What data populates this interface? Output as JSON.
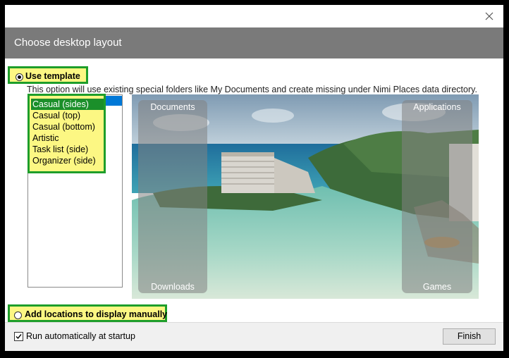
{
  "dialog": {
    "close_icon": "close-icon",
    "title": "Choose desktop layout"
  },
  "template_option": {
    "label": "Use template",
    "selected": true,
    "description": "This option will use existing special folders like My Documents and create missing under Nimi Places data directory."
  },
  "layouts": {
    "items": [
      {
        "label": "Casual (sides)",
        "selected": true
      },
      {
        "label": "Casual (top)",
        "selected": false
      },
      {
        "label": "Casual (bottom)",
        "selected": false
      },
      {
        "label": "Artistic",
        "selected": false
      },
      {
        "label": "Task list (side)",
        "selected": false
      },
      {
        "label": "Organizer (side)",
        "selected": false
      }
    ]
  },
  "preview": {
    "panels": {
      "top_left": "Documents",
      "bottom_left": "Downloads",
      "top_right": "Applications",
      "bottom_right": "Games"
    }
  },
  "manual_option": {
    "label": "Add locations to display manually",
    "selected": false
  },
  "footer": {
    "startup_label": "Run automatically at startup",
    "startup_checked": true,
    "finish_label": "Finish"
  },
  "colors": {
    "header": "#7a7a7a",
    "highlight_border": "#1e9e2a",
    "highlight_fill": "#fcf783",
    "selection": "#0078d7"
  }
}
